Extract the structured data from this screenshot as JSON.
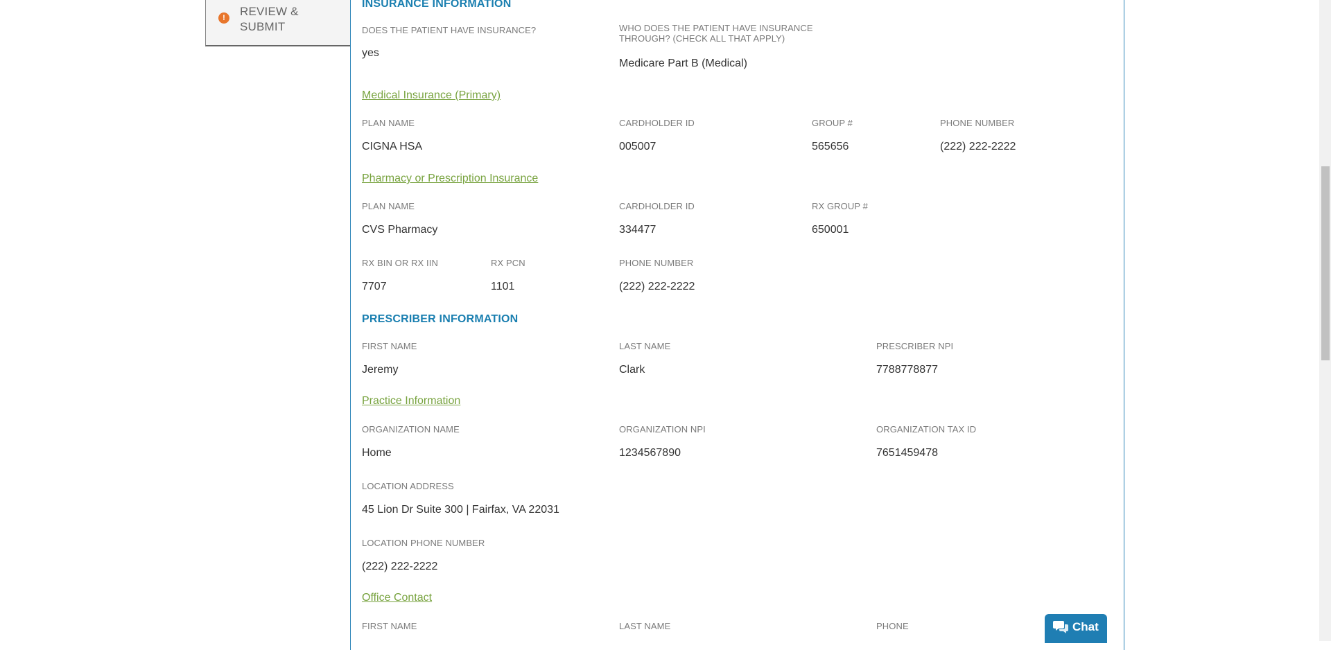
{
  "nav": {
    "step_icon": "!",
    "step_label": "REVIEW & SUBMIT"
  },
  "insurance": {
    "title": "INSURANCE INFORMATION",
    "has_insurance_label": "DOES THE PATIENT HAVE INSURANCE?",
    "has_insurance_value": "yes",
    "through_label": "WHO DOES THE PATIENT HAVE INSURANCE THROUGH? (CHECK ALL THAT APPLY)",
    "through_value": "Medicare Part B (Medical)",
    "medical": {
      "title": "Medical Insurance (Primary)",
      "plan_label": "PLAN NAME",
      "plan_value": "CIGNA HSA",
      "cardholder_label": "CARDHOLDER ID",
      "cardholder_value": "005007",
      "group_label": "GROUP #",
      "group_value": "565656",
      "phone_label": "PHONE NUMBER",
      "phone_value": "(222) 222-2222"
    },
    "pharmacy": {
      "title": "Pharmacy or Prescription Insurance",
      "plan_label": "PLAN NAME",
      "plan_value": "CVS Pharmacy",
      "cardholder_label": "CARDHOLDER ID",
      "cardholder_value": "334477",
      "rxgroup_label": "RX GROUP #",
      "rxgroup_value": "650001",
      "rxbin_label": "RX BIN OR RX IIN",
      "rxbin_value": "7707",
      "rxpcn_label": "RX PCN",
      "rxpcn_value": "1101",
      "phone_label": "PHONE NUMBER",
      "phone_value": "(222) 222-2222"
    }
  },
  "prescriber": {
    "title": "PRESCRIBER INFORMATION",
    "first_label": "FIRST NAME",
    "first_value": "Jeremy",
    "last_label": "LAST NAME",
    "last_value": "Clark",
    "npi_label": "PRESCRIBER NPI",
    "npi_value": "7788778877",
    "practice": {
      "title": "Practice Information",
      "org_name_label": "ORGANIZATION NAME",
      "org_name_value": "Home",
      "org_npi_label": "ORGANIZATION NPI",
      "org_npi_value": "1234567890",
      "org_tax_label": "ORGANIZATION TAX ID",
      "org_tax_value": "7651459478",
      "address_label": "LOCATION ADDRESS",
      "address_value": "45 Lion Dr Suite 300 | Fairfax, VA 22031",
      "loc_phone_label": "LOCATION PHONE NUMBER",
      "loc_phone_value": "(222) 222-2222"
    },
    "office_contact": {
      "title": "Office Contact",
      "first_label": "FIRST NAME",
      "last_label": "LAST NAME",
      "phone_label": "PHONE"
    }
  },
  "chat": {
    "label": "Chat",
    "icon": "chat-bubbles-icon"
  },
  "colors": {
    "section_title": "#1a7fb0",
    "subsection_title": "#78a33f",
    "alert_icon": "#e8762c",
    "panel_border": "#2a83b7",
    "chat_button": "#1f7eb3"
  }
}
